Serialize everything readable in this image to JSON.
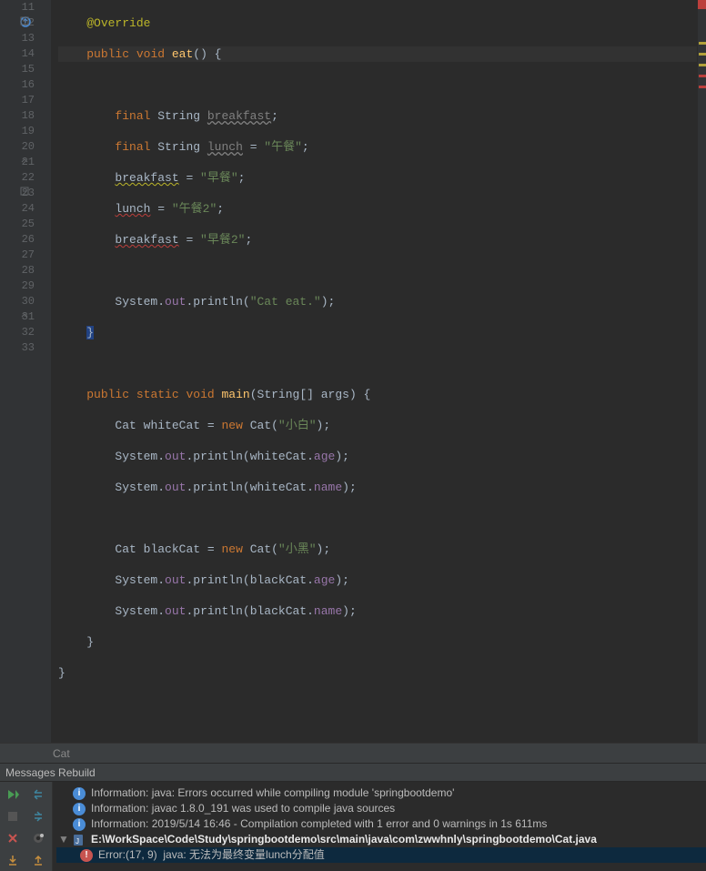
{
  "code": {
    "lines": [
      11,
      12,
      13,
      14,
      15,
      16,
      17,
      18,
      19,
      20,
      21,
      22,
      23,
      24,
      25,
      26,
      27,
      28,
      29,
      30,
      31,
      32,
      33
    ],
    "l11_annotation": "@Override",
    "l12_kw1": "public",
    "l12_kw2": "void",
    "l12_name": "eat",
    "l14_kw1": "final",
    "l14_type": "String",
    "l14_var": "breakfast",
    "l15_kw1": "final",
    "l15_type": "String",
    "l15_var": "lunch",
    "l15_val": "\"午餐\"",
    "l16_var": "breakfast",
    "l16_val": "\"早餐\"",
    "l17_var": "lunch",
    "l17_val": "\"午餐2\"",
    "l18_var": "breakfast",
    "l18_val": "\"早餐2\"",
    "l20_sys": "System",
    "l20_out": "out",
    "l20_m": "println",
    "l20_val": "\"Cat eat.\"",
    "l23_kw1": "public",
    "l23_kw2": "static",
    "l23_kw3": "void",
    "l23_name": "main",
    "l23_args": "String[] args",
    "l24_type": "Cat",
    "l24_var": "whiteCat",
    "l24_kw": "new",
    "l24_ctor": "Cat",
    "l24_val": "\"小白\"",
    "l25_sys": "System",
    "l25_out": "out",
    "l25_m": "println",
    "l25_arg": "whiteCat",
    "l25_f": "age",
    "l26_sys": "System",
    "l26_out": "out",
    "l26_m": "println",
    "l26_arg": "whiteCat",
    "l26_f": "name",
    "l28_type": "Cat",
    "l28_var": "blackCat",
    "l28_kw": "new",
    "l28_ctor": "Cat",
    "l28_val": "\"小黑\"",
    "l29_sys": "System",
    "l29_out": "out",
    "l29_m": "println",
    "l29_arg": "blackCat",
    "l29_f": "age",
    "l30_sys": "System",
    "l30_out": "out",
    "l30_m": "println",
    "l30_arg": "blackCat",
    "l30_f": "name"
  },
  "breadcrumb": {
    "label": "Cat"
  },
  "messages": {
    "header": "Messages Rebuild",
    "info1": "Information: java: Errors occurred while compiling module 'springbootdemo'",
    "info2": "Information: javac 1.8.0_191 was used to compile java sources",
    "info3": "Information: 2019/5/14 16:46 - Compilation completed with 1 error and 0 warnings in 1s 611ms",
    "filepath": "E:\\WorkSpace\\Code\\Study\\springbootdemo\\src\\main\\java\\com\\zwwhnly\\springbootdemo\\Cat.java",
    "err_loc": "Error:(17, 9)",
    "err_msg": "java:  无法为最终变量lunch分配值"
  }
}
